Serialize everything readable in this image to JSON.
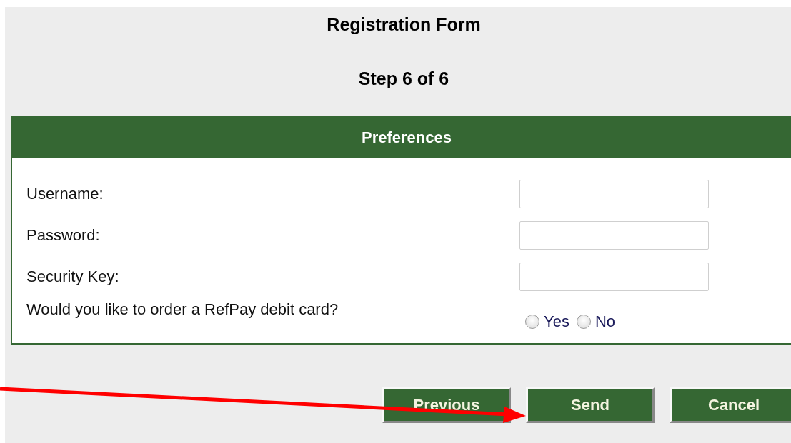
{
  "title": "Registration Form",
  "step": "Step 6 of 6",
  "section": {
    "heading": "Preferences",
    "fields": [
      {
        "kind": "text",
        "label": "Username:"
      },
      {
        "kind": "text",
        "label": "Password:"
      },
      {
        "kind": "text",
        "label": "Security Key:"
      },
      {
        "kind": "radio",
        "label": "Would you like to order a RefPay debit card?",
        "options": [
          {
            "label": "Yes",
            "selected": false
          },
          {
            "label": "No",
            "selected": false
          }
        ]
      }
    ]
  },
  "buttons": [
    "Previous",
    "Send",
    "Cancel"
  ],
  "annotation": {
    "kind": "arrow"
  }
}
